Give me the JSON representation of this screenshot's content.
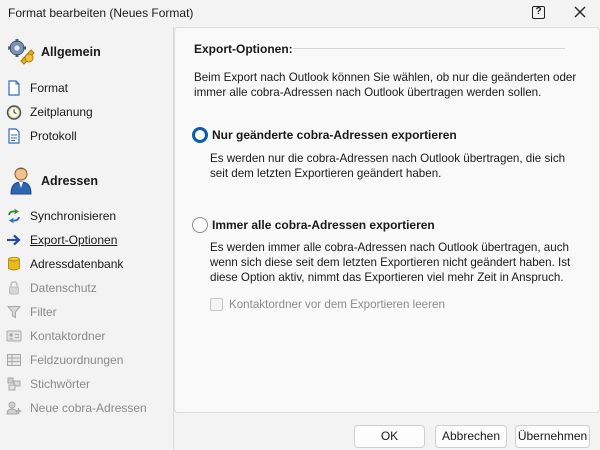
{
  "window": {
    "title": "Format bearbeiten (Neues Format)",
    "help_glyph": "?",
    "help_icon": "help-icon",
    "close_icon": "close-icon"
  },
  "sidebar": {
    "sections": [
      {
        "label": "Allgemein",
        "icon": "gears-icon",
        "items": [
          {
            "label": "Format",
            "icon": "document-icon",
            "disabled": false
          },
          {
            "label": "Zeitplanung",
            "icon": "clock-icon",
            "disabled": false
          },
          {
            "label": "Protokoll",
            "icon": "log-icon",
            "disabled": false
          }
        ]
      },
      {
        "label": "Adressen",
        "icon": "person-icon",
        "items": [
          {
            "label": "Synchronisieren",
            "icon": "sync-icon",
            "disabled": false
          },
          {
            "label": "Export-Optionen",
            "icon": "arrow-right-icon",
            "disabled": false,
            "active": true
          },
          {
            "label": "Adressdatenbank",
            "icon": "database-icon",
            "disabled": false
          },
          {
            "label": "Datenschutz",
            "icon": "lock-icon",
            "disabled": true
          },
          {
            "label": "Filter",
            "icon": "filter-icon",
            "disabled": true
          },
          {
            "label": "Kontaktordner",
            "icon": "contact-card-icon",
            "disabled": true
          },
          {
            "label": "Feldzuordnungen",
            "icon": "table-icon",
            "disabled": true
          },
          {
            "label": "Stichwörter",
            "icon": "keywords-icon",
            "disabled": true
          },
          {
            "label": "Neue cobra-Adressen",
            "icon": "new-address-icon",
            "disabled": true
          }
        ]
      }
    ]
  },
  "main": {
    "group_title": "Export-Optionen:",
    "intro": "Beim Export nach Outlook können Sie wählen, ob nur die geänderten oder immer alle cobra-Adressen nach Outlook übertragen werden sollen.",
    "options": [
      {
        "label": "Nur geänderte cobra-Adressen exportieren",
        "checked": true,
        "description": "Es werden nur die cobra-Adressen nach Outlook übertragen, die sich seit dem letzten Exportieren geändert haben."
      },
      {
        "label": "Immer alle cobra-Adressen exportieren",
        "checked": false,
        "description": "Es werden immer alle cobra-Adressen nach Outlook übertragen, auch wenn sich diese seit dem letzten Exportieren nicht geändert haben. Ist diese Option aktiv, nimmt das Exportieren viel mehr Zeit in Anspruch."
      }
    ],
    "checkbox": {
      "label": "Kontaktordner vor dem Exportieren leeren",
      "checked": false,
      "disabled": true
    }
  },
  "footer": {
    "ok_label": "OK",
    "cancel_label": "Abbrechen",
    "apply_label": "Übernehmen"
  },
  "colors": {
    "accent": "#0b5cad",
    "disabled_text": "#8a8a8a",
    "background": "#f3f3f3"
  }
}
